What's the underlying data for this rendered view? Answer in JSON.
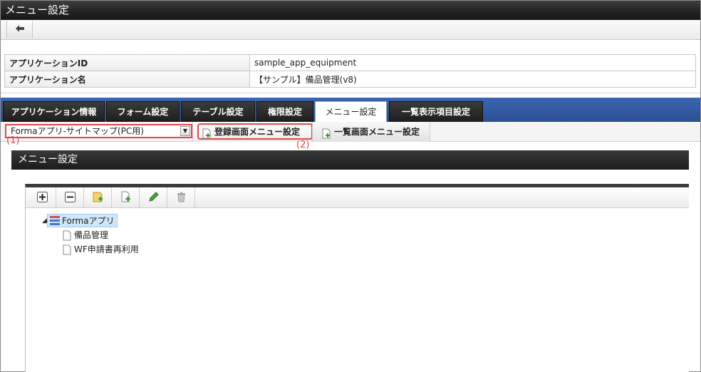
{
  "window": {
    "title": "メニュー設定"
  },
  "info": {
    "rows": [
      {
        "label": "アプリケーションID",
        "value": "sample_app_equipment"
      },
      {
        "label": "アプリケーション名",
        "value": "【サンプル】備品管理(v8)"
      }
    ]
  },
  "tabs": [
    {
      "label": "アプリケーション情報"
    },
    {
      "label": "フォーム設定"
    },
    {
      "label": "テーブル設定"
    },
    {
      "label": "権限設定"
    },
    {
      "label": "メニュー設定",
      "active": true
    },
    {
      "label": "一覧表示項目設定"
    }
  ],
  "subbar": {
    "select_value": "Formaアプリ-サイトマップ(PC用)",
    "subtabs": [
      {
        "label": "登録画面メニュー設定"
      },
      {
        "label": "一覧画面メニュー設定"
      }
    ],
    "callout1": "(1)",
    "callout2": "(2)"
  },
  "section": {
    "title": "メニュー設定"
  },
  "tree": {
    "root": "Formaアプリ",
    "children": [
      "備品管理",
      "WF申請書再利用"
    ]
  },
  "icons": {
    "back": "arrow-left-icon",
    "expand": "plus-icon",
    "collapse": "minus-icon",
    "add_folder": "add-folder-icon",
    "add_page": "add-page-icon",
    "edit": "pencil-icon",
    "delete": "trash-icon"
  },
  "colors": {
    "tab_strip": "#2f5aa2",
    "highlight": "#e04848",
    "selection": "#cfe7f8"
  }
}
